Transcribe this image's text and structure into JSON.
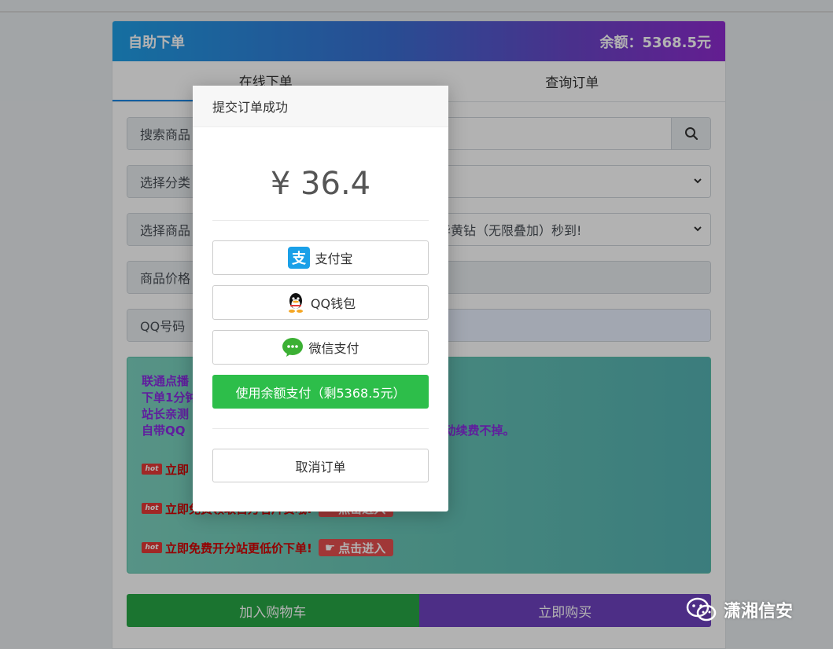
{
  "header": {
    "title": "自助下单",
    "balance": "余额：5368.5元"
  },
  "tabs": [
    {
      "label": "在线下单"
    },
    {
      "label": "查询订单"
    }
  ],
  "form": {
    "search_label": "搜索商品",
    "category_label": "选择分类",
    "product_label": "选择商品",
    "product_value": "华黄钻（无限叠加）秒到!",
    "price_label": "商品价格",
    "qq_label": "QQ号码"
  },
  "notice": {
    "line1": "联通点播",
    "line2": "下单1分钟",
    "line3": "站长亲测",
    "line4a": "自带QQ",
    "line4b": "自动续费不掉。",
    "promo1": "立即",
    "promo2": "立即免费领取百万名片赞哦!",
    "promo3": "立即免费开分站更低价下单!",
    "enter_label": "点击进入",
    "hot_label": "hot"
  },
  "buttons": {
    "add_cart": "加入购物车",
    "buy_now": "立即购买"
  },
  "modal": {
    "title": "提交订单成功",
    "amount": "¥ 36.4",
    "alipay": "支付宝",
    "qqwallet": "QQ钱包",
    "wechat": "微信支付",
    "balance_pay": "使用余额支付（剩5368.5元）",
    "cancel": "取消订单"
  },
  "watermark": {
    "text": "潇湘信安"
  },
  "colors": {
    "accent_green": "#2dbe4a",
    "accent_purple": "#6f42c1",
    "header_start": "#1f9fe6",
    "header_end": "#8f2bd0"
  },
  "icons": {
    "search": "search-icon",
    "alipay": "alipay-icon",
    "qq": "qq-icon",
    "wechat": "wechat-icon"
  }
}
